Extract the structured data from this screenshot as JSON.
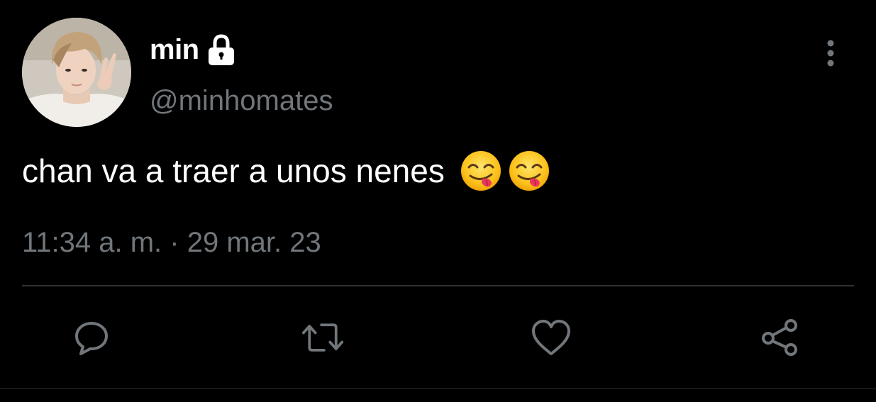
{
  "author": {
    "display_name": "min",
    "handle": "@minhomates",
    "protected_icon": "lock-icon",
    "avatar": "avatar"
  },
  "tweet": {
    "text": "chan va a traer a unos nenes",
    "emojis": [
      "face-savoring-food-emoji",
      "face-savoring-food-emoji"
    ],
    "time": "11:34 a. m.",
    "separator": "·",
    "date": "29 mar. 23"
  },
  "actions": [
    {
      "icon": "reply-icon"
    },
    {
      "icon": "retweet-icon"
    },
    {
      "icon": "heart-icon"
    },
    {
      "icon": "share-icon"
    }
  ],
  "menu": {
    "icon": "more-vertical-icon"
  },
  "colors": {
    "background": "#000000",
    "primary_text": "#ffffff",
    "secondary_text": "#71767b",
    "divider": "#2f3336"
  }
}
